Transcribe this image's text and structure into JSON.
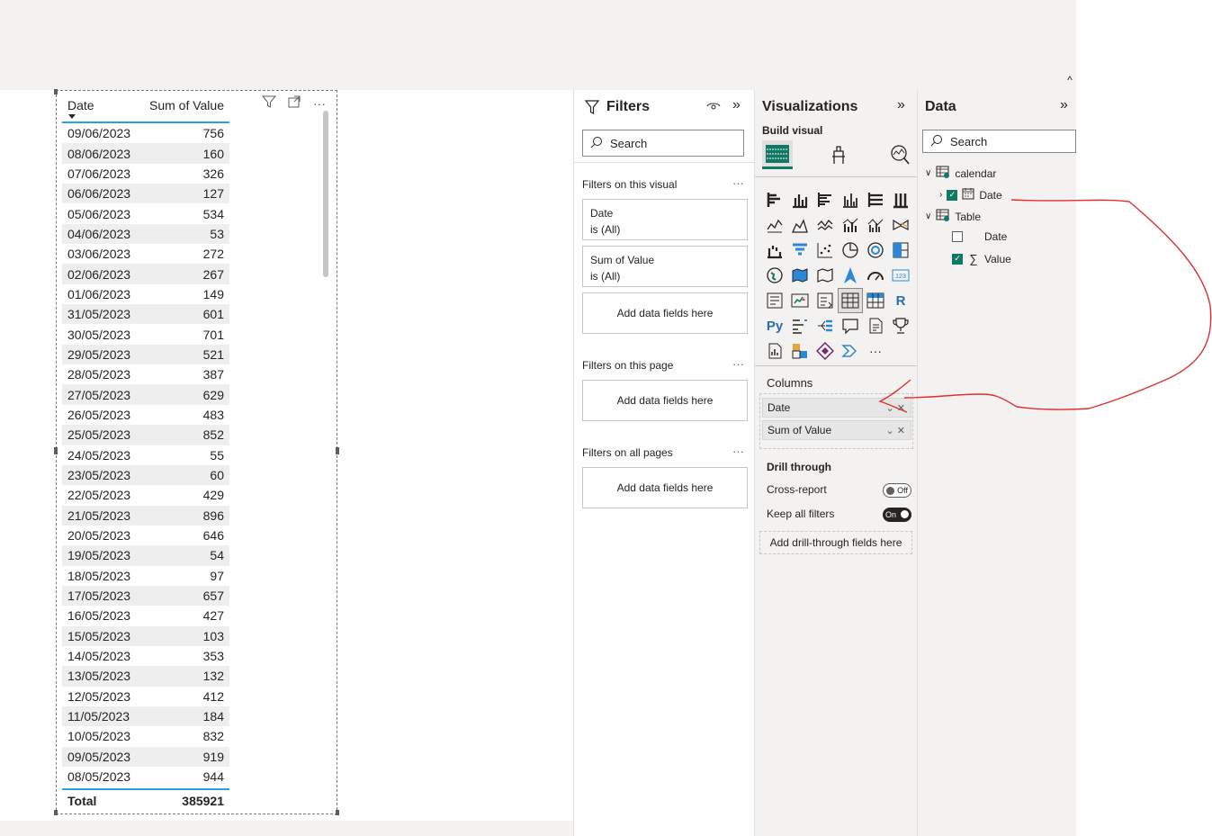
{
  "ribbon": {
    "collapse_glyph": "^"
  },
  "table_visual": {
    "columns": [
      "Date",
      "Sum of Value"
    ],
    "rows": [
      [
        "09/06/2023",
        "756"
      ],
      [
        "08/06/2023",
        "160"
      ],
      [
        "07/06/2023",
        "326"
      ],
      [
        "06/06/2023",
        "127"
      ],
      [
        "05/06/2023",
        "534"
      ],
      [
        "04/06/2023",
        "53"
      ],
      [
        "03/06/2023",
        "272"
      ],
      [
        "02/06/2023",
        "267"
      ],
      [
        "01/06/2023",
        "149"
      ],
      [
        "31/05/2023",
        "601"
      ],
      [
        "30/05/2023",
        "701"
      ],
      [
        "29/05/2023",
        "521"
      ],
      [
        "28/05/2023",
        "387"
      ],
      [
        "27/05/2023",
        "629"
      ],
      [
        "26/05/2023",
        "483"
      ],
      [
        "25/05/2023",
        "852"
      ],
      [
        "24/05/2023",
        "55"
      ],
      [
        "23/05/2023",
        "60"
      ],
      [
        "22/05/2023",
        "429"
      ],
      [
        "21/05/2023",
        "896"
      ],
      [
        "20/05/2023",
        "646"
      ],
      [
        "19/05/2023",
        "54"
      ],
      [
        "18/05/2023",
        "97"
      ],
      [
        "17/05/2023",
        "657"
      ],
      [
        "16/05/2023",
        "427"
      ],
      [
        "15/05/2023",
        "103"
      ],
      [
        "14/05/2023",
        "353"
      ],
      [
        "13/05/2023",
        "132"
      ],
      [
        "12/05/2023",
        "412"
      ],
      [
        "11/05/2023",
        "184"
      ],
      [
        "10/05/2023",
        "832"
      ],
      [
        "09/05/2023",
        "919"
      ],
      [
        "08/05/2023",
        "944"
      ]
    ],
    "total_label": "Total",
    "total_value": "385921",
    "icons": [
      "filter-icon",
      "focus-mode-icon",
      "more-options-icon"
    ]
  },
  "filters": {
    "title": "Filters",
    "search_placeholder": "Search",
    "on_visual_label": "Filters on this visual",
    "card1_field": "Date",
    "card1_state": "is (All)",
    "card2_field": "Sum of Value",
    "card2_state": "is (All)",
    "add_fields": "Add data fields here",
    "on_page_label": "Filters on this page",
    "on_all_label": "Filters on all pages",
    "more": "···"
  },
  "visualizations": {
    "title": "Visualizations",
    "build_label": "Build visual",
    "columns_label": "Columns",
    "well_items": [
      "Date",
      "Sum of Value"
    ],
    "drill_label": "Drill through",
    "cross_report_label": "Cross-report",
    "cross_report_state": "Off",
    "keep_filters_label": "Keep all filters",
    "keep_filters_state": "On",
    "add_drill": "Add drill-through fields here",
    "more_visuals": "···",
    "py_label": "Py",
    "r_label": "R",
    "card_label": "123"
  },
  "data_pane": {
    "title": "Data",
    "search_placeholder": "Search",
    "tables": [
      {
        "name": "calendar",
        "fields": [
          {
            "name": "Date",
            "checked": true
          }
        ]
      },
      {
        "name": "Table",
        "fields": [
          {
            "name": "Date",
            "checked": false
          },
          {
            "name": "Value",
            "checked": true
          }
        ]
      }
    ]
  },
  "colors": {
    "accent": "#117865",
    "header_rule": "#2aa3dd",
    "annotation": "#e03030"
  }
}
